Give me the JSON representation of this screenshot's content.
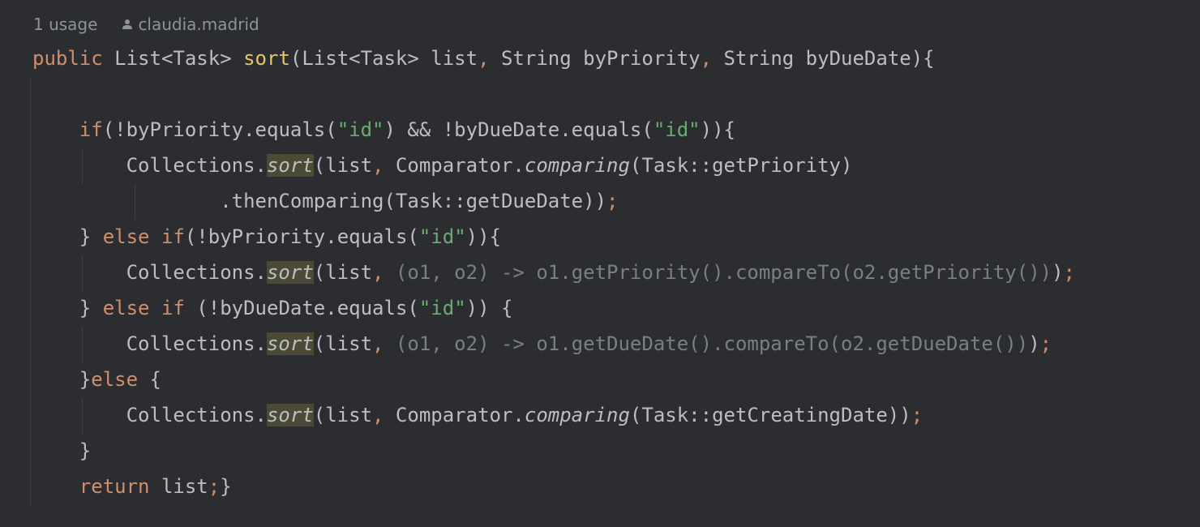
{
  "meta": {
    "usages": "1 usage",
    "author": "claudia.madrid",
    "person_icon": "person-icon"
  },
  "colors": {
    "background": "#2b2d30",
    "text": "#bcbec4",
    "keyword": "#cf8e6d",
    "method": "#e8c46a",
    "string": "#6aab73",
    "muted": "#8f939a",
    "dim": "#7a7e85",
    "highlight": "#4b4a35"
  },
  "code": {
    "lines": [
      [
        {
          "t": "public",
          "c": "kw"
        },
        {
          "t": " List<Task> "
        },
        {
          "t": "sort",
          "c": "fn"
        },
        {
          "t": "(List<Task> list"
        },
        {
          "t": ",",
          "c": "kw"
        },
        {
          "t": " String byPriority"
        },
        {
          "t": ",",
          "c": "kw"
        },
        {
          "t": " String byDueDate){"
        }
      ],
      [],
      [
        {
          "t": "    "
        },
        {
          "t": "if",
          "c": "kw"
        },
        {
          "t": "(!byPriority.equals("
        },
        {
          "t": "\"id\"",
          "c": "str"
        },
        {
          "t": ") && !byDueDate.equals("
        },
        {
          "t": "\"id\"",
          "c": "str"
        },
        {
          "t": ")){"
        }
      ],
      [
        {
          "t": "        Collections."
        },
        {
          "t": "sort",
          "c": "it hl"
        },
        {
          "t": "(list"
        },
        {
          "t": ",",
          "c": "kw"
        },
        {
          "t": " Comparator."
        },
        {
          "t": "comparing",
          "c": "it"
        },
        {
          "t": "(Task::getPriority)"
        }
      ],
      [
        {
          "t": "                .thenComparing(Task::getDueDate))"
        },
        {
          "t": ";",
          "c": "kw"
        }
      ],
      [
        {
          "t": "    } "
        },
        {
          "t": "else if",
          "c": "kw"
        },
        {
          "t": "(!byPriority.equals("
        },
        {
          "t": "\"id\"",
          "c": "str"
        },
        {
          "t": ")){"
        }
      ],
      [
        {
          "t": "        Collections."
        },
        {
          "t": "sort",
          "c": "it hl"
        },
        {
          "t": "(list"
        },
        {
          "t": ",",
          "c": "kw"
        },
        {
          "t": " (o1, o2) -> o1.getPriority().compareTo(o2.getPriority())",
          "c": "dim"
        },
        {
          "t": ")"
        },
        {
          "t": ";",
          "c": "kw"
        }
      ],
      [
        {
          "t": "    } "
        },
        {
          "t": "else if",
          "c": "kw"
        },
        {
          "t": " (!byDueDate.equals("
        },
        {
          "t": "\"id\"",
          "c": "str"
        },
        {
          "t": ")) {"
        }
      ],
      [
        {
          "t": "        Collections."
        },
        {
          "t": "sort",
          "c": "it hl"
        },
        {
          "t": "(list"
        },
        {
          "t": ",",
          "c": "kw"
        },
        {
          "t": " (o1, o2) -> o1.getDueDate().compareTo(o2.getDueDate())",
          "c": "dim"
        },
        {
          "t": ")"
        },
        {
          "t": ";",
          "c": "kw"
        }
      ],
      [
        {
          "t": "    }"
        },
        {
          "t": "else",
          "c": "kw"
        },
        {
          "t": " {"
        }
      ],
      [
        {
          "t": "        Collections."
        },
        {
          "t": "sort",
          "c": "it hl"
        },
        {
          "t": "(list"
        },
        {
          "t": ",",
          "c": "kw"
        },
        {
          "t": " Comparator."
        },
        {
          "t": "comparing",
          "c": "it"
        },
        {
          "t": "(Task::getCreatingDate))"
        },
        {
          "t": ";",
          "c": "kw"
        }
      ],
      [
        {
          "t": "    }"
        }
      ],
      [
        {
          "t": "    "
        },
        {
          "t": "return",
          "c": "kw"
        },
        {
          "t": " list"
        },
        {
          "t": ";",
          "c": "kw"
        },
        {
          "t": "}"
        }
      ]
    ]
  }
}
